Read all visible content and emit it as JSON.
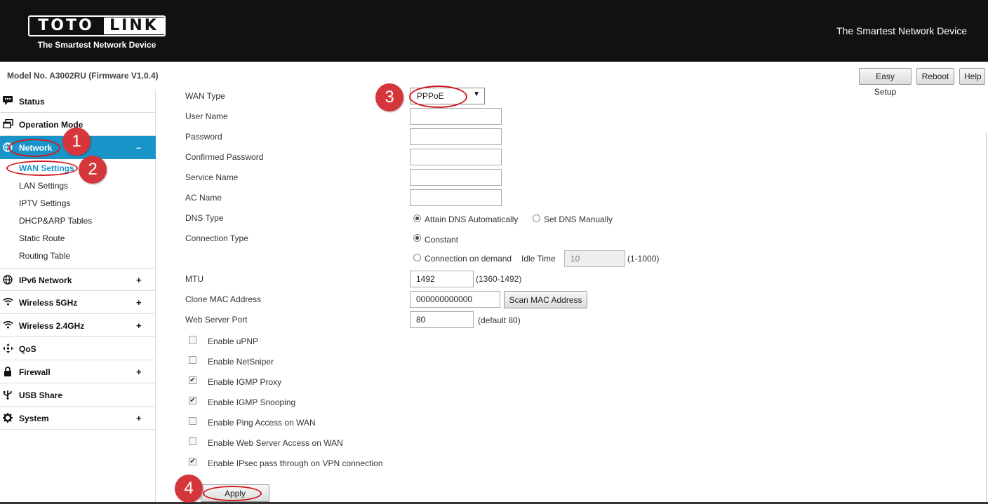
{
  "header": {
    "logo_left": "TOTO",
    "logo_right": "LINK",
    "logo_tagline": "The Smartest Network Device",
    "slogan": "The Smartest Network Device"
  },
  "topbar": {
    "model": "Model No. A3002RU (Firmware V1.0.4)",
    "easy_setup": "Easy Setup",
    "reboot": "Reboot",
    "help": "Help"
  },
  "sidebar": {
    "items": [
      {
        "label": "Status",
        "icon": "chat-icon",
        "toggle": ""
      },
      {
        "label": "Operation Mode",
        "icon": "windows-icon",
        "toggle": ""
      },
      {
        "label": "Network",
        "icon": "globe-icon",
        "toggle": "–"
      },
      {
        "label": "IPv6 Network",
        "icon": "globe-icon",
        "toggle": "+"
      },
      {
        "label": "Wireless 5GHz",
        "icon": "wifi-icon",
        "toggle": "+"
      },
      {
        "label": "Wireless 2.4GHz",
        "icon": "wifi-icon",
        "toggle": "+"
      },
      {
        "label": "QoS",
        "icon": "qos-icon",
        "toggle": ""
      },
      {
        "label": "Firewall",
        "icon": "lock-icon",
        "toggle": "+"
      },
      {
        "label": "USB Share",
        "icon": "usb-icon",
        "toggle": ""
      },
      {
        "label": "System",
        "icon": "gear-icon",
        "toggle": "+"
      }
    ],
    "network_sub": [
      "WAN Settings",
      "LAN Settings",
      "IPTV Settings",
      "DHCP&ARP Tables",
      "Static Route",
      "Routing Table"
    ]
  },
  "form": {
    "wan_type_label": "WAN Type",
    "wan_type_value": "PPPoE",
    "user_name_label": "User Name",
    "password_label": "Password",
    "confirmed_password_label": "Confirmed Password",
    "service_name_label": "Service Name",
    "ac_name_label": "AC Name",
    "dns_type_label": "DNS Type",
    "dns_auto": "Attain DNS Automatically",
    "dns_manual": "Set DNS Manually",
    "connection_type_label": "Connection Type",
    "conn_constant": "Constant",
    "conn_on_demand": "Connection on demand",
    "idle_time_label": "Idle Time",
    "idle_time_value": "10",
    "idle_time_range": "(1-1000)",
    "mtu_label": "MTU",
    "mtu_value": "1492",
    "mtu_range": "(1360-1492)",
    "clone_mac_label": "Clone MAC Address",
    "clone_mac_value": "000000000000",
    "scan_mac_button": "Scan MAC Address",
    "web_port_label": "Web Server Port",
    "web_port_value": "80",
    "web_port_note": "(default 80)",
    "checkboxes": [
      {
        "label": "Enable uPNP",
        "checked": false
      },
      {
        "label": "Enable NetSniper",
        "checked": false
      },
      {
        "label": "Enable IGMP Proxy",
        "checked": true
      },
      {
        "label": "Enable IGMP Snooping",
        "checked": true
      },
      {
        "label": "Enable Ping Access on WAN",
        "checked": false
      },
      {
        "label": "Enable Web Server Access on WAN",
        "checked": false
      },
      {
        "label": "Enable IPsec pass through on VPN connection",
        "checked": true
      }
    ],
    "apply_button": "Apply"
  },
  "annotations": {
    "step1": "1",
    "step2": "2",
    "step3": "3",
    "step4": "4",
    "color": "#d5363b"
  },
  "colors": {
    "header_bg": "#111111",
    "active_nav": "#1994c8"
  }
}
